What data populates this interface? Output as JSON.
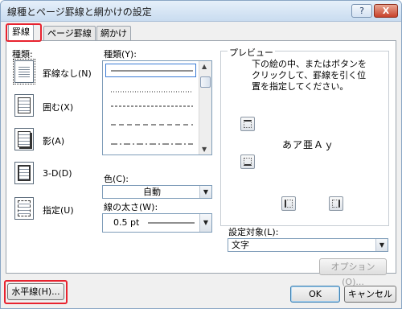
{
  "window": {
    "title": "線種とページ罫線と網かけの設定",
    "help_label": "?",
    "close_label": "X"
  },
  "tabs": [
    {
      "label": "罫線",
      "active": true
    },
    {
      "label": "ページ罫線",
      "active": false
    },
    {
      "label": "網かけ",
      "active": false
    }
  ],
  "settings": {
    "heading": "種類:",
    "items": [
      {
        "label": "罫線なし(N)",
        "icon": "no-border-icon"
      },
      {
        "label": "囲む(X)",
        "icon": "box-border-icon"
      },
      {
        "label": "影(A)",
        "icon": "shadow-border-icon"
      },
      {
        "label": "3-D(D)",
        "icon": "3d-border-icon"
      },
      {
        "label": "指定(U)",
        "icon": "custom-border-icon"
      }
    ]
  },
  "style": {
    "heading": "種類(Y):",
    "styles": [
      "solid",
      "dotted",
      "dashed-short",
      "dashed",
      "dash-dot"
    ]
  },
  "color": {
    "label": "色(C):",
    "value": "自動"
  },
  "width": {
    "label": "線の太さ(W):",
    "value": "0.5 pt"
  },
  "preview": {
    "heading": "プレビュー",
    "instructions": [
      "下の絵の中、またはボタンを",
      "クリックして、罫線を引く位",
      "置を指定してください。"
    ],
    "sample_text": "あア亜Ａｙ"
  },
  "apply_to": {
    "label": "設定対象(L):",
    "value": "文字"
  },
  "buttons": {
    "options": "オプション(O)...",
    "horizontal_line": "水平線(H)...",
    "ok": "OK",
    "cancel": "キャンセル"
  },
  "colors": {
    "highlight": "#e8232f",
    "title_bar": "#c9dcf0"
  }
}
